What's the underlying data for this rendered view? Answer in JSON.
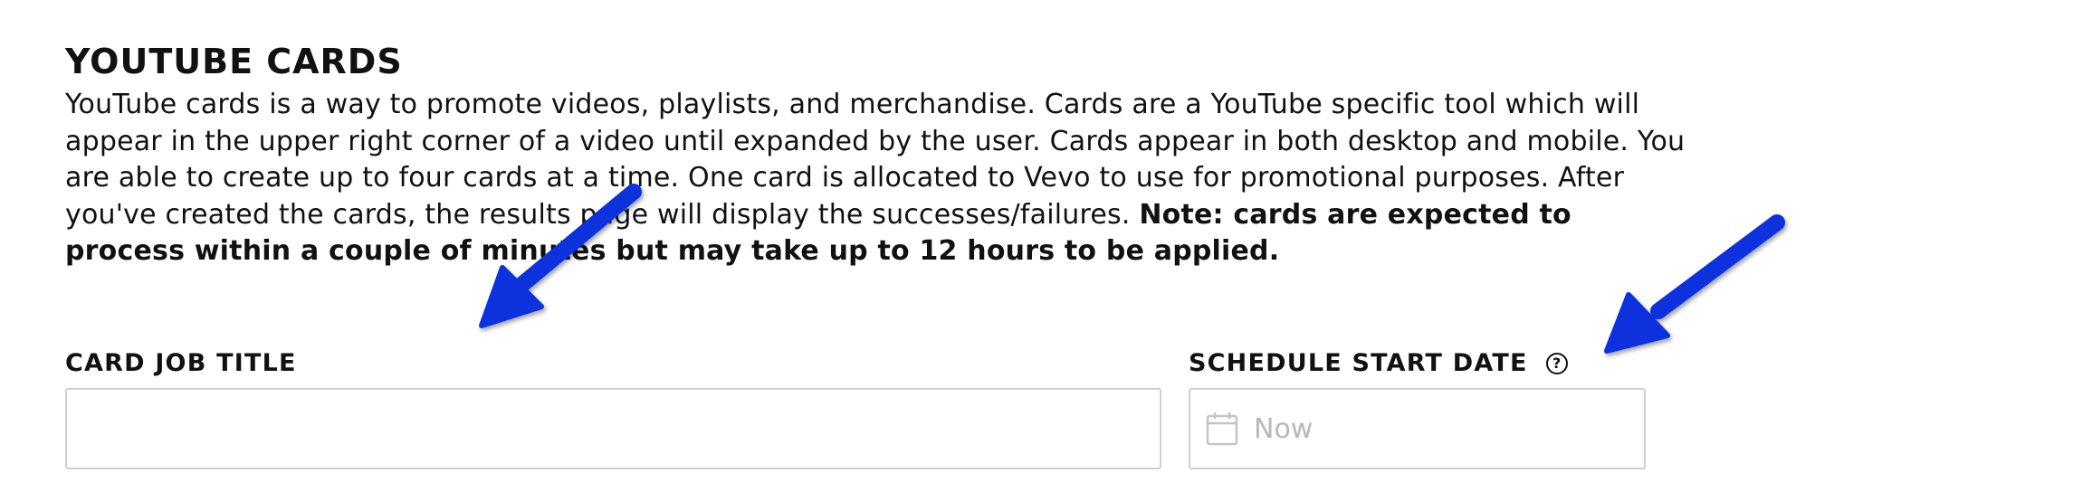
{
  "section": {
    "title": "YOUTUBE CARDS",
    "description": "YouTube cards is a way to promote videos, playlists, and merchandise. Cards are a YouTube specific tool which will appear in the upper right corner of a video until expanded by the user. Cards appear in both desktop and mobile. You are able to create up to four cards at a time. One card is allocated to Vevo to use for promotional purposes. After you've created the cards, the results page will display the successes/failures.",
    "note": "Note: cards are expected to process within a couple of minutes but may take up to 12 hours to be applied."
  },
  "form": {
    "card_job_title": {
      "label": "CARD JOB TITLE",
      "value": ""
    },
    "schedule_start_date": {
      "label": "SCHEDULE START DATE",
      "help_icon": "?",
      "placeholder": "Now",
      "value": ""
    }
  },
  "icons": {
    "help": "question-circle-icon",
    "calendar": "calendar-icon"
  },
  "colors": {
    "text": "#111111",
    "input_border": "#cfcfcf",
    "placeholder": "#b8b8b8",
    "annotation_arrow": "#1133dd"
  }
}
